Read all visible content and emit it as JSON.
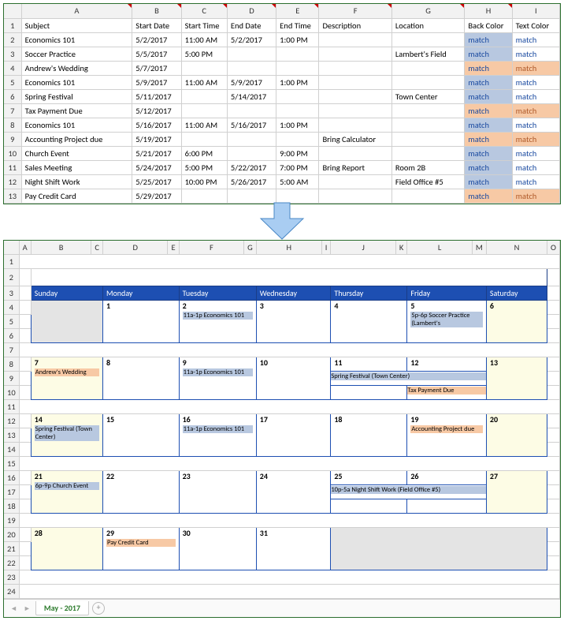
{
  "top": {
    "cols": [
      "A",
      "B",
      "C",
      "D",
      "E",
      "F",
      "G",
      "H",
      "I"
    ],
    "headers": {
      "A": "Subject",
      "B": "Start Date",
      "C": "Start Time",
      "D": "End Date",
      "E": "End Time",
      "F": "Description",
      "G": "Location",
      "H": "Back Color",
      "I": "Text Color"
    },
    "rows": [
      {
        "n": 2,
        "A": "Economics 101",
        "B": "5/2/2017",
        "C": "11:00 AM",
        "D": "5/2/2017",
        "E": "1:00 PM",
        "F": "",
        "G": "",
        "H": "match",
        "I": "match",
        "Hc": "blue",
        "Ic": "plain"
      },
      {
        "n": 3,
        "A": "Soccer Practice",
        "B": "5/5/2017",
        "C": "5:00 PM",
        "D": "",
        "E": "",
        "F": "",
        "G": "Lambert's Field",
        "H": "match",
        "I": "match",
        "Hc": "blue",
        "Ic": "plain"
      },
      {
        "n": 4,
        "A": "Andrew's Wedding",
        "B": "5/7/2017",
        "C": "",
        "D": "",
        "E": "",
        "F": "",
        "G": "",
        "H": "match",
        "I": "match",
        "Hc": "orange",
        "Ic": "orange"
      },
      {
        "n": 5,
        "A": "Economics 101",
        "B": "5/9/2017",
        "C": "11:00 AM",
        "D": "5/9/2017",
        "E": "1:00 PM",
        "F": "",
        "G": "",
        "H": "match",
        "I": "match",
        "Hc": "blue",
        "Ic": "plain"
      },
      {
        "n": 6,
        "A": "Spring Festival",
        "B": "5/11/2017",
        "C": "",
        "D": "5/14/2017",
        "E": "",
        "F": "",
        "G": "Town Center",
        "H": "match",
        "I": "match",
        "Hc": "blue",
        "Ic": "plain"
      },
      {
        "n": 7,
        "A": "Tax Payment Due",
        "B": "5/12/2017",
        "C": "",
        "D": "",
        "E": "",
        "F": "",
        "G": "",
        "H": "match",
        "I": "match",
        "Hc": "orange",
        "Ic": "orange"
      },
      {
        "n": 8,
        "A": "Economics 101",
        "B": "5/16/2017",
        "C": "11:00 AM",
        "D": "5/16/2017",
        "E": "1:00 PM",
        "F": "",
        "G": "",
        "H": "match",
        "I": "match",
        "Hc": "blue",
        "Ic": "plain"
      },
      {
        "n": 9,
        "A": "Accounting Project due",
        "B": "5/19/2017",
        "C": "",
        "D": "",
        "E": "",
        "F": "Bring Calculator",
        "G": "",
        "H": "match",
        "I": "match",
        "Hc": "orange",
        "Ic": "orange"
      },
      {
        "n": 10,
        "A": "Church Event",
        "B": "5/21/2017",
        "C": "6:00 PM",
        "D": "",
        "E": "9:00 PM",
        "F": "",
        "G": "",
        "H": "match",
        "I": "match",
        "Hc": "blue",
        "Ic": "plain"
      },
      {
        "n": 11,
        "A": "Sales Meeting",
        "B": "5/24/2017",
        "C": "5:00 PM",
        "D": "5/22/2017",
        "E": "7:00 PM",
        "F": "Bring Report",
        "G": "Room 2B",
        "H": "match",
        "I": "match",
        "Hc": "blue",
        "Ic": "plain"
      },
      {
        "n": 12,
        "A": "Night Shift Work",
        "B": "5/25/2017",
        "C": "10:00 PM",
        "D": "5/26/2017",
        "E": "5:00 AM",
        "F": "",
        "G": "Field Office #5",
        "H": "match",
        "I": "match",
        "Hc": "blue",
        "Ic": "plain"
      },
      {
        "n": 13,
        "A": "Pay Credit Card",
        "B": "5/29/2017",
        "C": "",
        "D": "",
        "E": "",
        "F": "",
        "G": "",
        "H": "match",
        "I": "match",
        "Hc": "orange",
        "Ic": "orange"
      }
    ]
  },
  "cal": {
    "cols": [
      "A",
      "B",
      "C",
      "D",
      "E",
      "F",
      "G",
      "H",
      "I",
      "J",
      "K",
      "L",
      "M",
      "N",
      "O"
    ],
    "title": "May 2017",
    "dow": [
      "Sunday",
      "Monday",
      "Tuesday",
      "Wednesday",
      "Thursday",
      "Friday",
      "Saturday"
    ],
    "tab": "May - 2017",
    "events": {
      "w1d3a": "11a-1p Economics 101",
      "w1d6a": "5p-6p Soccer Practice (Lambert's",
      "w2d1a": "Andrew's Wedding",
      "w2d3a": "11a-1p Economics 101",
      "w2d5a": "Spring Festival (Town Center)",
      "w2d6a": "Tax Payment Due",
      "w3d1a": "Spring Festival (Town Center)",
      "w3d3a": "11a-1p Economics 101",
      "w3d6a": "Accounting Project due",
      "w4d1a": "6p-9p Church Event",
      "w4d5a": "10p-5a Night Shift Work (Field Office #5)",
      "w5d2a": "Pay Credit Card"
    },
    "days": {
      "w1": [
        "",
        "1",
        "2",
        "3",
        "4",
        "5",
        "6"
      ],
      "w2": [
        "7",
        "8",
        "9",
        "10",
        "11",
        "12",
        "13"
      ],
      "w3": [
        "14",
        "15",
        "16",
        "17",
        "18",
        "19",
        "20"
      ],
      "w4": [
        "21",
        "22",
        "23",
        "24",
        "25",
        "26",
        "27"
      ],
      "w5": [
        "28",
        "29",
        "30",
        "31",
        "",
        "",
        ""
      ]
    }
  }
}
